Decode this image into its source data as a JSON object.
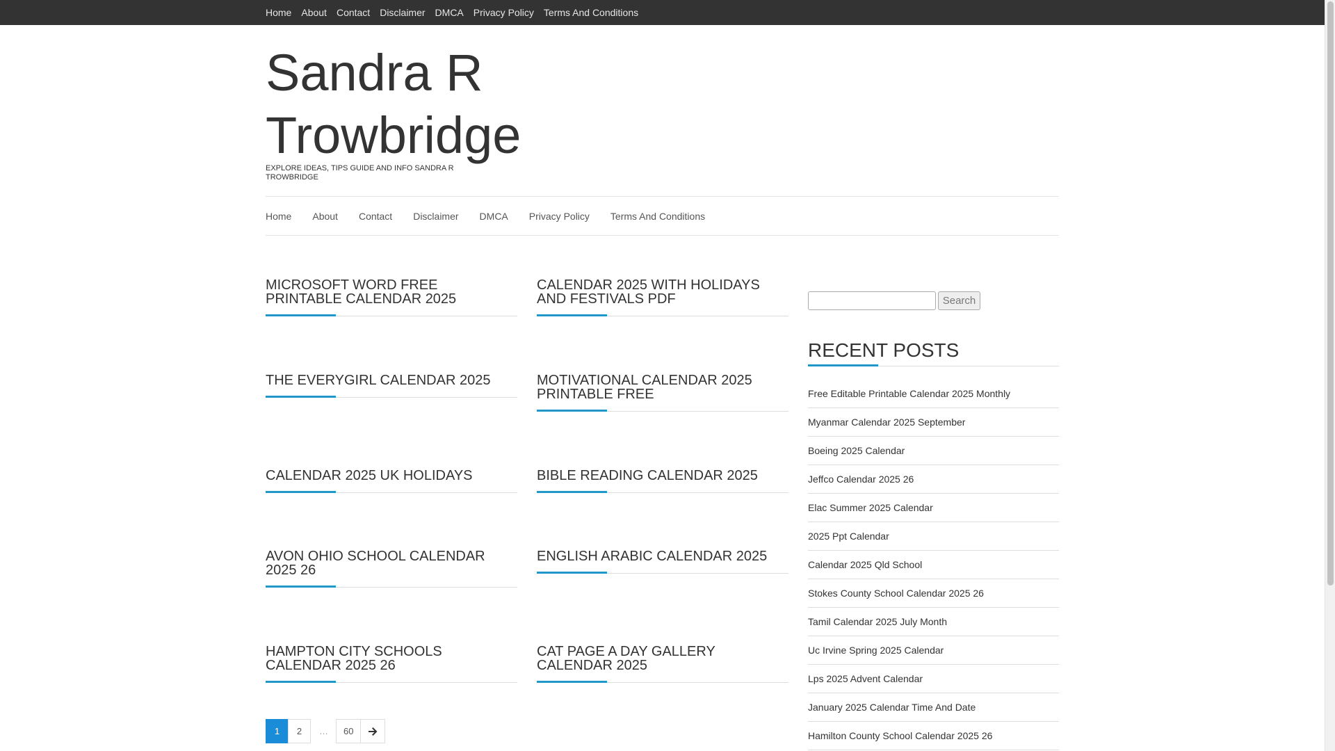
{
  "topbar": {
    "items": [
      "Home",
      "About",
      "Contact",
      "Disclaimer",
      "DMCA",
      "Privacy Policy",
      "Terms And Conditions"
    ]
  },
  "header": {
    "title": "Sandra R Trowbridge",
    "tagline": "EXPLORE IDEAS, TIPS GUIDE AND INFO SANDRA R TROWBRIDGE"
  },
  "main_nav": {
    "items": [
      "Home",
      "About",
      "Contact",
      "Disclaimer",
      "DMCA",
      "Privacy Policy",
      "Terms And Conditions"
    ]
  },
  "posts": [
    "MICROSOFT WORD FREE PRINTABLE CALENDAR 2025",
    "CALENDAR 2025 WITH HOLIDAYS AND FESTIVALS PDF",
    "THE EVERYGIRL CALENDAR 2025",
    "MOTIVATIONAL CALENDAR 2025 PRINTABLE FREE",
    "CALENDAR 2025 UK HOLIDAYS",
    "BIBLE READING CALENDAR 2025",
    "AVON OHIO SCHOOL CALENDAR 2025 26",
    "ENGLISH ARABIC CALENDAR 2025",
    "HAMPTON CITY SCHOOLS CALENDAR 2025 26",
    "CAT PAGE A DAY GALLERY CALENDAR 2025"
  ],
  "pagination": {
    "current": "1",
    "next_page": "2",
    "ellipsis": "…",
    "last": "60",
    "next_icon": "arrow-right-icon"
  },
  "sidebar": {
    "search": {
      "value": "",
      "button_label": "Search"
    },
    "recent_title": "RECENT POSTS",
    "recent_posts": [
      "Free Editable Printable Calendar 2025 Monthly",
      "Myanmar Calendar 2025 September",
      "Boeing 2025 Calendar",
      "Jeffco Calendar 2025 26",
      "Elac Summer 2025 Calendar",
      "2025 Ppt Calendar",
      "Calendar 2025 Qld School",
      "Stokes County School Calendar 2025 26",
      "Tamil Calendar 2025 July Month",
      "Uc Irvine Spring 2025 Calendar",
      "Lps 2025 Advent Calendar",
      "January 2025 Calendar Time And Date",
      "Hamilton County School Calendar 2025 26"
    ]
  },
  "colors": {
    "topbar_bg": "#333333",
    "accent": "#2196c9",
    "pagination_active": "#1a8cd8"
  }
}
